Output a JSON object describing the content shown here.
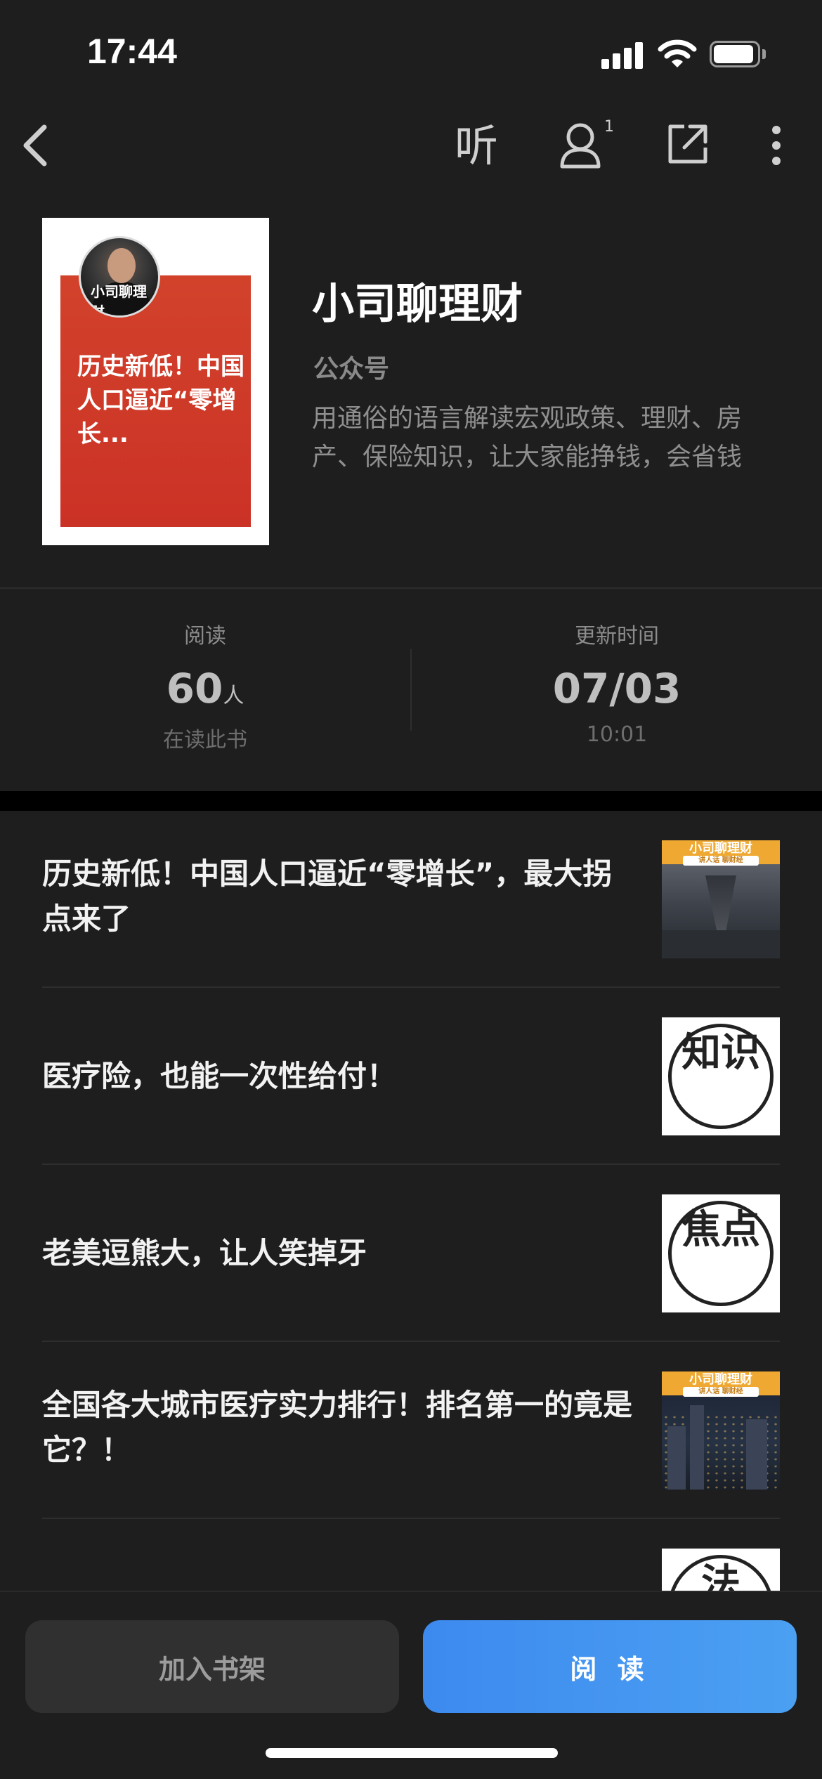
{
  "status_bar": {
    "time": "17:44"
  },
  "nav": {
    "back_icon": "chevron-left-icon",
    "listen_label": "听",
    "user_badge": "1",
    "share_icon": "share-external-icon",
    "more_icon": "more-vertical-icon"
  },
  "book": {
    "cover_text": "历史新低！中国人口逼近“零增长...",
    "cover_logo": "小司聊理财",
    "title": "小司聊理财",
    "subtitle": "公众号",
    "description": "用通俗的语言解读宏观政策、理财、房产、保险知识，让大家能挣钱，会省钱"
  },
  "stats": {
    "reading": {
      "label": "阅读",
      "value": "60",
      "unit": "人",
      "sub": "在读此书"
    },
    "updated": {
      "label": "更新时间",
      "value": "07/03",
      "sub": "10:01"
    }
  },
  "articles": [
    {
      "title": "历史新低！中国人口逼近“零增长”，最大拐点来了",
      "thumb_banner": "小司聊理财",
      "thumb_banner_sub": "讲人话 聊财经"
    },
    {
      "title": "医疗险，也能一次性给付！",
      "thumb_text": "知识"
    },
    {
      "title": "老美逗熊大，让人笑掉牙",
      "thumb_text": "焦点"
    },
    {
      "title": "全国各大城市医疗实力排行！排名第一的竟是它？！",
      "thumb_banner": "小司聊理财",
      "thumb_banner_sub": "讲人话 聊财经"
    },
    {
      "title": "",
      "thumb_text": "法"
    }
  ],
  "buttons": {
    "add_shelf": "加入书架",
    "read": "阅 读"
  },
  "colors": {
    "accent": "#3d8aef",
    "background": "#1e1e1e",
    "cover_red": "#cb3226",
    "banner_orange": "#efa932"
  }
}
